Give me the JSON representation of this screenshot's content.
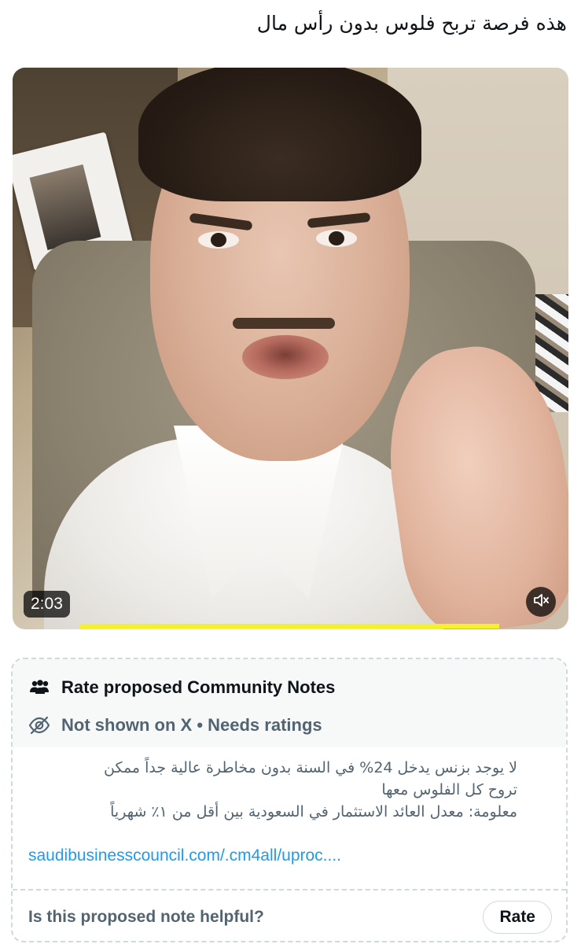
{
  "tweet": {
    "text": "هذه فرصة تربح فلوس بدون رأس مال"
  },
  "video": {
    "timestamp": "2:03",
    "mute_icon": "speaker-muted-icon",
    "progress_color": "#f4f12a"
  },
  "note": {
    "title": "Rate proposed Community Notes",
    "status": "Not shown on X • Needs ratings",
    "people_icon": "people-icon",
    "hidden_icon": "eye-slash-icon",
    "lines": [
      "لا يوجد بزنس يدخل 24% في السنة بدون مخاطرة عالية جداً ممكن",
      "تروح كل الفلوس معها",
      "معلومة: معدل العائد الاستثمار في السعودية بين أقل من ١٪ شهرياً"
    ],
    "link": "saudibusinesscouncil.com/.cm4all/uproc....",
    "link_color": "#1d9bf0",
    "question": "Is this proposed note helpful?",
    "rate_label": "Rate"
  }
}
